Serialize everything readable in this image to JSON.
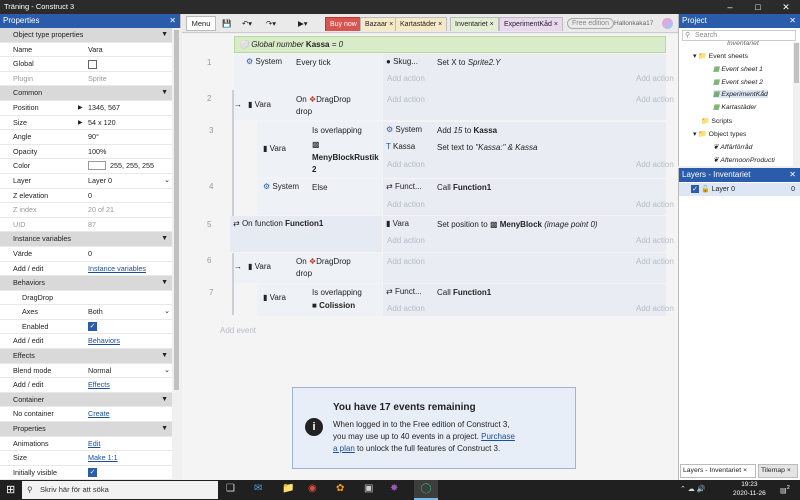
{
  "window": {
    "title": "Träning - Construct 3"
  },
  "properties": {
    "header": "Properties",
    "rows": [
      {
        "kind": "sec",
        "label": "Object type properties"
      },
      {
        "label": "Name",
        "value": "Vara"
      },
      {
        "label": "Global",
        "check": false
      },
      {
        "label": "Plugin",
        "value": "Sprite",
        "dim": true
      },
      {
        "kind": "sec",
        "label": "Common"
      },
      {
        "label": "Position",
        "value": "1346, 567",
        "arrow": true
      },
      {
        "label": "Size",
        "value": "54 x 120",
        "arrow": true
      },
      {
        "label": "Angle",
        "value": "90°"
      },
      {
        "label": "Opacity",
        "value": "100%"
      },
      {
        "label": "Color",
        "value": "255, 255, 255",
        "swatch": true
      },
      {
        "label": "Layer",
        "value": "Layer 0",
        "dd": true
      },
      {
        "label": "Z elevation",
        "value": "0"
      },
      {
        "label": "Z index",
        "value": "20 of 21",
        "dim": true
      },
      {
        "label": "UID",
        "value": "87",
        "dim": true
      },
      {
        "kind": "sec",
        "label": "Instance variables"
      },
      {
        "label": "Värde",
        "value": "0"
      },
      {
        "label": "Add / edit",
        "value": "Instance variables",
        "link": true
      },
      {
        "kind": "sec",
        "label": "Behaviors"
      },
      {
        "label": "DragDrop",
        "sub": true
      },
      {
        "label": "Axes",
        "value": "Both",
        "dd": true,
        "indent": true
      },
      {
        "label": "Enabled",
        "check": true,
        "indent": true
      },
      {
        "label": "Add / edit",
        "value": "Behaviors",
        "link": true
      },
      {
        "kind": "sec",
        "label": "Effects"
      },
      {
        "label": "Blend mode",
        "value": "Normal",
        "dd": true
      },
      {
        "label": "Add / edit",
        "value": "Effects",
        "link": true
      },
      {
        "kind": "sec",
        "label": "Container"
      },
      {
        "label": "No container",
        "value": "Create",
        "link": true
      },
      {
        "kind": "sec",
        "label": "Properties"
      },
      {
        "label": "Animations",
        "value": "Edit",
        "link": true
      },
      {
        "label": "Size",
        "value": "Make 1:1",
        "link": true
      },
      {
        "label": "Initially visible",
        "check": true
      }
    ]
  },
  "toolbar": {
    "menu": "Menu",
    "tabs": [
      "Buy now",
      "Bazaar",
      "Kartastäder",
      "Inventariet",
      "ExperimentKåd"
    ],
    "badge": "Free edition",
    "user": "Hallonkaka17"
  },
  "sheet": {
    "global_prefix": "Global number",
    "global_name": "Kassa",
    "global_value": "= 0",
    "add_action": "Add action",
    "add_event": "Add event",
    "e1": {
      "num": "1",
      "obj": "System",
      "cond": "Every tick",
      "aobj": "Skug...",
      "act_pre": "Set X to",
      "act_val": "Sprite2.Y"
    },
    "e2": {
      "num": "2",
      "obj": "Vara",
      "cond_pre": "On",
      "cond_name": "DragDrop",
      "cond_post": "drop"
    },
    "e3": {
      "num": "3",
      "obj": "Vara",
      "cond": "Is overlapping",
      "cond_obj": "MenyBlockRustik2",
      "a1obj": "System",
      "a1_pre": "Add",
      "a1_num": "15",
      "a1_to": "to",
      "a1_var": "Kassa",
      "a2obj": "Kassa",
      "a2_pre": "Set text to",
      "a2_val": "\"Kassa:\" & Kassa"
    },
    "e4": {
      "num": "4",
      "obj": "System",
      "cond": "Else",
      "aobj": "Funct...",
      "act_pre": "Call",
      "act_fn": "Function1"
    },
    "e5": {
      "num": "5",
      "cond_pre": "On function",
      "cond_fn": "Function1",
      "aobj": "Vara",
      "act_pre": "Set position to",
      "act_obj": "MenyBlock",
      "act_post": "(image point 0)"
    },
    "e6": {
      "num": "6",
      "obj": "Vara",
      "cond_pre": "On",
      "cond_name": "DragDrop",
      "cond_post": "drop"
    },
    "e7": {
      "num": "7",
      "obj": "Vara",
      "cond": "Is overlapping",
      "cond_obj": "Colission",
      "aobj": "Funct...",
      "act_pre": "Call",
      "act_fn": "Function1"
    }
  },
  "notice": {
    "title": "You have 17 events remaining",
    "body1": "When logged in to the Free edition of Construct 3,",
    "body2": "you may use up to 40 events in a project.",
    "link1": "Purchase",
    "link2": "a plan",
    "body3": "to unlock the full features of Construct 3."
  },
  "project": {
    "header": "Project",
    "search_placeholder": "Search",
    "items": [
      "Inventariet",
      "Event sheets",
      "Event sheet 1",
      "Event sheet 2",
      "ExperimentKåd",
      "Kartastäder",
      "Scripts",
      "Object types",
      "Affärförråd",
      "AfternoonProducti"
    ]
  },
  "layers": {
    "header": "Layers - Inventariet",
    "layer_name": "Layer 0",
    "layer_count": "0"
  },
  "bottom_tabs": [
    "Layers - Inventariet",
    "Tilemap"
  ],
  "taskbar": {
    "search": "Skriv här för att söka",
    "time": "19:23",
    "date": "2020-11-26",
    "notif": "2"
  },
  "colors": {
    "accent": "#2a5cab",
    "buy": "#d9534f",
    "global_band": "#d9ecc9"
  }
}
